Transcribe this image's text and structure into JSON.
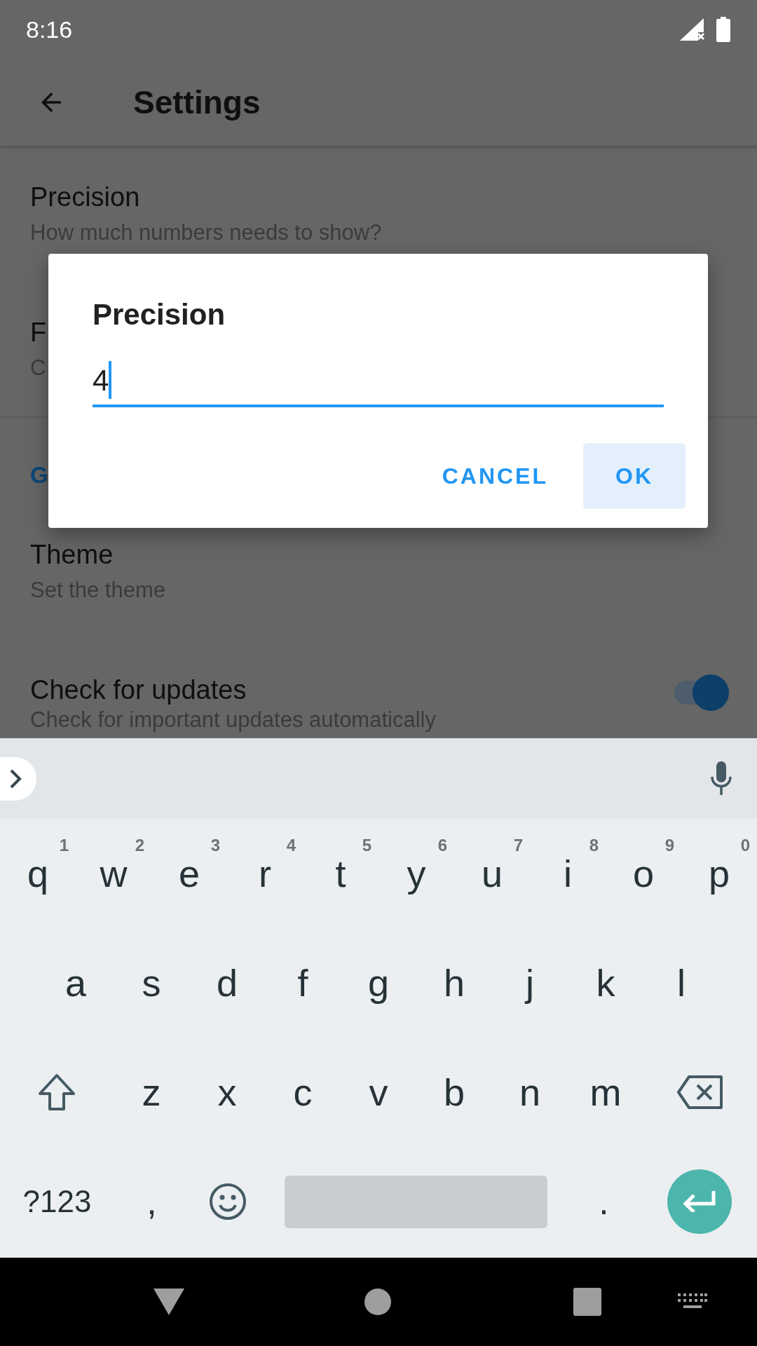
{
  "status_bar": {
    "time": "8:16"
  },
  "app_bar": {
    "title": "Settings"
  },
  "settings": [
    {
      "kind": "item",
      "title": "Precision",
      "summary": "How much numbers needs to show?"
    },
    {
      "kind": "item",
      "title": "F",
      "summary": "C"
    },
    {
      "kind": "category",
      "title": "G"
    },
    {
      "kind": "item",
      "title": "Theme",
      "summary": "Set the theme"
    },
    {
      "kind": "switch",
      "title": "Check for updates",
      "summary": "Check for important updates automatically",
      "on": true
    }
  ],
  "dialog": {
    "title": "Precision",
    "value": "4",
    "buttons": [
      {
        "label": "CANCEL",
        "focused": false
      },
      {
        "label": "OK",
        "focused": true
      }
    ]
  },
  "keyboard": {
    "rows": [
      {
        "keys": [
          {
            "kind": "letter",
            "label": "q",
            "hint": "1"
          },
          {
            "kind": "letter",
            "label": "w",
            "hint": "2"
          },
          {
            "kind": "letter",
            "label": "e",
            "hint": "3"
          },
          {
            "kind": "letter",
            "label": "r",
            "hint": "4"
          },
          {
            "kind": "letter",
            "label": "t",
            "hint": "5"
          },
          {
            "kind": "letter",
            "label": "y",
            "hint": "6"
          },
          {
            "kind": "letter",
            "label": "u",
            "hint": "7"
          },
          {
            "kind": "letter",
            "label": "i",
            "hint": "8"
          },
          {
            "kind": "letter",
            "label": "o",
            "hint": "9"
          },
          {
            "kind": "letter",
            "label": "p",
            "hint": "0"
          }
        ]
      },
      {
        "keys": [
          {
            "kind": "letter",
            "label": "a"
          },
          {
            "kind": "letter",
            "label": "s"
          },
          {
            "kind": "letter",
            "label": "d"
          },
          {
            "kind": "letter",
            "label": "f"
          },
          {
            "kind": "letter",
            "label": "g"
          },
          {
            "kind": "letter",
            "label": "h"
          },
          {
            "kind": "letter",
            "label": "j"
          },
          {
            "kind": "letter",
            "label": "k"
          },
          {
            "kind": "letter",
            "label": "l"
          }
        ]
      },
      {
        "keys": [
          {
            "kind": "shift"
          },
          {
            "kind": "letter",
            "label": "z"
          },
          {
            "kind": "letter",
            "label": "x"
          },
          {
            "kind": "letter",
            "label": "c"
          },
          {
            "kind": "letter",
            "label": "v"
          },
          {
            "kind": "letter",
            "label": "b"
          },
          {
            "kind": "letter",
            "label": "n"
          },
          {
            "kind": "letter",
            "label": "m"
          },
          {
            "kind": "backspace"
          }
        ]
      },
      {
        "keys": [
          {
            "kind": "symbols",
            "label": "?123"
          },
          {
            "kind": "comma",
            "label": ","
          },
          {
            "kind": "emoji"
          },
          {
            "kind": "space"
          },
          {
            "kind": "period",
            "label": "."
          },
          {
            "kind": "enter"
          }
        ]
      }
    ]
  }
}
